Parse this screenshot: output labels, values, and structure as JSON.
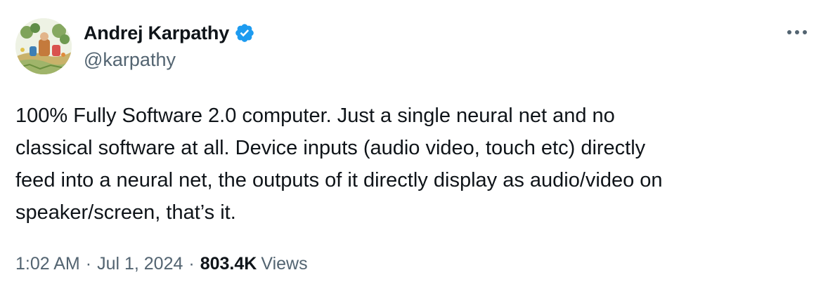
{
  "author": {
    "display_name": "Andrej Karpathy",
    "handle": "@karpathy",
    "verified": true,
    "avatar_icon": "avatar-illustration"
  },
  "more_icon": "more-icon",
  "tweet": {
    "lines": [
      "100% Fully Software 2.0 computer. Just a single neural net and no",
      "classical software at all. Device inputs (audio video, touch etc) directly",
      "feed into a neural net, the outputs of it directly display as audio/video on",
      "speaker/screen, that’s it."
    ]
  },
  "meta": {
    "time": "1:02 AM",
    "separator": "·",
    "date": "Jul 1, 2024",
    "views_count": "803.4K",
    "views_label": "Views"
  },
  "colors": {
    "text_primary": "#0f1419",
    "text_secondary": "#536471",
    "verified_blue": "#1d9bf0"
  }
}
